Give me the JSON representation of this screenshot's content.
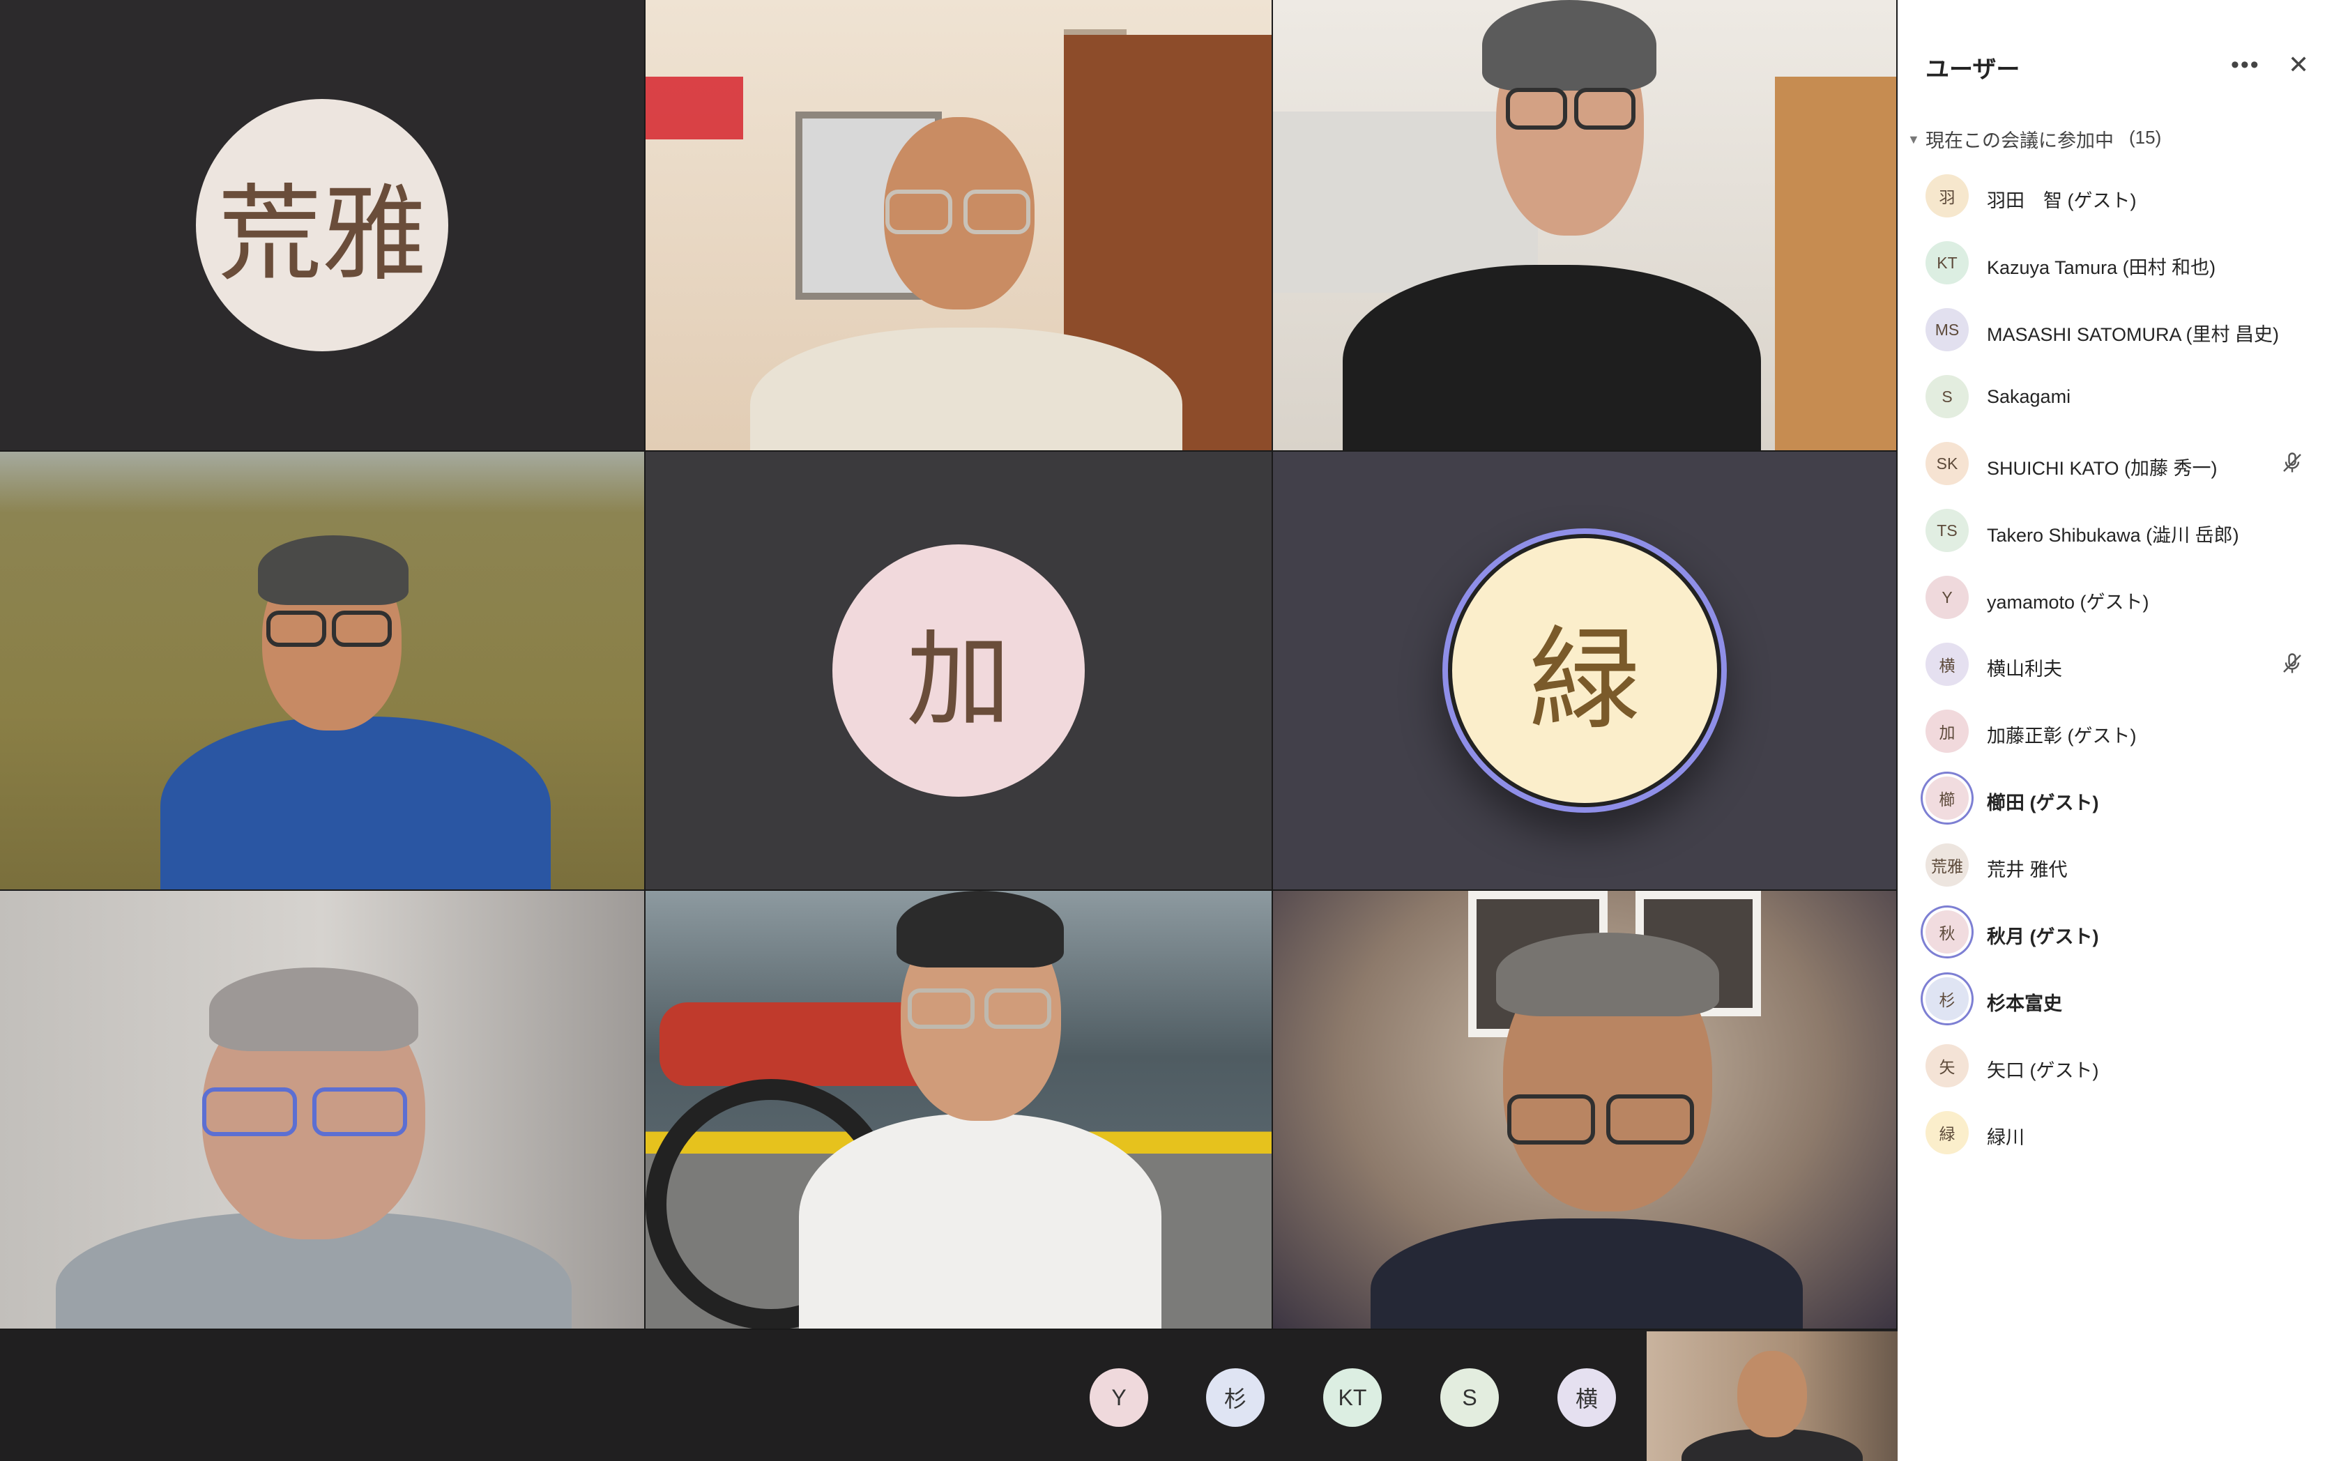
{
  "video_grid": {
    "tiles": [
      {
        "kind": "avatar",
        "text": "荒雅",
        "color": "#ede5df",
        "bg": "#2c2a2c"
      },
      {
        "kind": "video",
        "scene": "man-hawaiian-shirt-room"
      },
      {
        "kind": "video",
        "scene": "man-black-shirt-room"
      },
      {
        "kind": "video",
        "scene": "man-blue-shirt-grassland"
      },
      {
        "kind": "avatar",
        "text": "加",
        "color": "#f1d9dc",
        "bg": "#3b3a3d"
      },
      {
        "kind": "avatar",
        "text": "緑",
        "color": "#fbeecb",
        "bg": "#42404a",
        "speaking": true
      },
      {
        "kind": "video",
        "scene": "man-grey-sweater-blurred"
      },
      {
        "kind": "video",
        "scene": "man-white-tshirt-motorcycle"
      },
      {
        "kind": "video",
        "scene": "man-navy-shirt-room"
      }
    ]
  },
  "bottom_strip": {
    "avatars": [
      {
        "text": "Y",
        "color": "#efd9dc"
      },
      {
        "text": "杉",
        "color": "#dfe4f3"
      },
      {
        "text": "KT",
        "color": "#dceee2"
      },
      {
        "text": "S",
        "color": "#e3eddf"
      },
      {
        "text": "横",
        "color": "#e5e0f0"
      }
    ],
    "self_view": "self-camera"
  },
  "panel": {
    "title": "ユーザー",
    "more_label": "•••",
    "close_label": "✕",
    "section_label": "現在この会議に参加中",
    "section_count": "(15)",
    "participants": [
      {
        "initials": "羽",
        "name": "羽田　智 (ゲスト)",
        "color": "#f6e7cd",
        "bold": false,
        "ring": false,
        "muted": false
      },
      {
        "initials": "KT",
        "name": "Kazuya Tamura (田村 和也)",
        "color": "#dceee2",
        "bold": false,
        "ring": false,
        "muted": false
      },
      {
        "initials": "MS",
        "name": "MASASHI SATOMURA (里村 昌史)",
        "color": "#e2e0ef",
        "bold": false,
        "ring": false,
        "muted": false
      },
      {
        "initials": "S",
        "name": "Sakagami",
        "color": "#e3eddf",
        "bold": false,
        "ring": false,
        "muted": false
      },
      {
        "initials": "SK",
        "name": "SHUICHI KATO (加藤 秀一)",
        "color": "#f6e3d2",
        "bold": false,
        "ring": false,
        "muted": true
      },
      {
        "initials": "TS",
        "name": "Takero Shibukawa (澁川 岳郎)",
        "color": "#e1eee2",
        "bold": false,
        "ring": false,
        "muted": false
      },
      {
        "initials": "Y",
        "name": "yamamoto (ゲスト)",
        "color": "#efd9dc",
        "bold": false,
        "ring": false,
        "muted": false
      },
      {
        "initials": "横",
        "name": "横山利夫",
        "color": "#e5e0f0",
        "bold": false,
        "ring": false,
        "muted": true
      },
      {
        "initials": "加",
        "name": "加藤正彰 (ゲスト)",
        "color": "#f1d9dc",
        "bold": false,
        "ring": false,
        "muted": false
      },
      {
        "initials": "櫛",
        "name": "櫛田 (ゲスト)",
        "color": "#f1dcdf",
        "bold": true,
        "ring": true,
        "muted": false
      },
      {
        "initials": "荒雅",
        "name": "荒井 雅代",
        "color": "#ede5df",
        "bold": false,
        "ring": false,
        "muted": false
      },
      {
        "initials": "秋",
        "name": "秋月 (ゲスト)",
        "color": "#f1dcdf",
        "bold": true,
        "ring": true,
        "muted": false
      },
      {
        "initials": "杉",
        "name": "杉本富史",
        "color": "#dfe4f3",
        "bold": true,
        "ring": true,
        "muted": false
      },
      {
        "initials": "矢",
        "name": "矢口 (ゲスト)",
        "color": "#f4e3d6",
        "bold": false,
        "ring": false,
        "muted": false
      },
      {
        "initials": "緑",
        "name": "緑川",
        "color": "#fbeecb",
        "bold": false,
        "ring": false,
        "muted": false
      }
    ]
  },
  "colors": {
    "speaking_ring": "#8f8fe8",
    "panel_ring": "#7d7fd3"
  }
}
